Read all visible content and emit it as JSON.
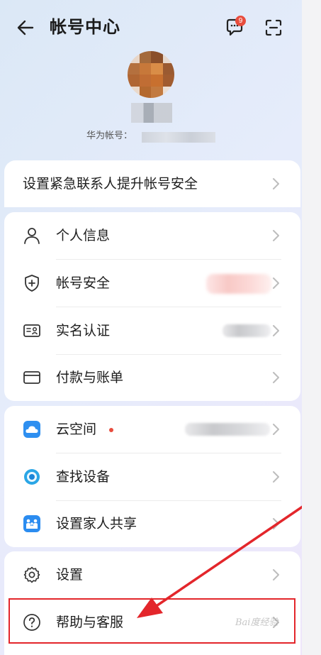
{
  "header": {
    "title": "帐号中心",
    "message_badge": "9"
  },
  "profile": {
    "account_label": "华为帐号："
  },
  "emergency_contact": {
    "label": "设置紧急联系人提升帐号安全"
  },
  "group1": {
    "items": [
      {
        "label": "个人信息",
        "icon": "person-icon"
      },
      {
        "label": "帐号安全",
        "icon": "shield-plus-icon"
      },
      {
        "label": "实名认证",
        "icon": "id-card-icon"
      },
      {
        "label": "付款与账单",
        "icon": "card-icon"
      }
    ]
  },
  "group2": {
    "items": [
      {
        "label": "云空间",
        "icon": "cloud-icon"
      },
      {
        "label": "查找设备",
        "icon": "find-device-icon"
      },
      {
        "label": "设置家人共享",
        "icon": "family-share-icon"
      }
    ]
  },
  "group3": {
    "items": [
      {
        "label": "设置",
        "icon": "gear-icon"
      },
      {
        "label": "帮助与客服",
        "icon": "help-icon"
      }
    ]
  },
  "watermark": "Bai度经验",
  "colors": {
    "accent_red": "#e3262b",
    "badge_red": "#e84c3d",
    "card_bg": "#ffffff",
    "cloud_blue": "#2e8ff0"
  }
}
